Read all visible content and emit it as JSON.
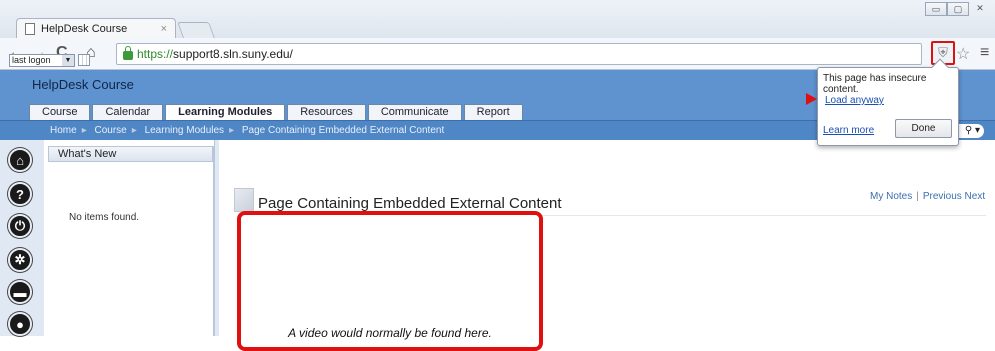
{
  "browser": {
    "tab_title": "HelpDesk Course",
    "tab_close": "×",
    "url_https": "https://",
    "url_rest": "support8.sln.suny.edu/",
    "win_controls": [
      "▭",
      "▢",
      "✕"
    ]
  },
  "lms": {
    "course_title": "HelpDesk Course",
    "nav_tabs": [
      "Course",
      "Calendar",
      "Learning Modules",
      "Resources",
      "Communicate",
      "Report"
    ],
    "breadcrumb": [
      "Home",
      "Course",
      "Learning Modules",
      "Page Containing Embedded External Content"
    ],
    "pill_text": "⚲ ▾"
  },
  "sidebar": {
    "panel_title": "What's New",
    "filter_value": "last logon",
    "empty_text": "No items found."
  },
  "content": {
    "page_title": "Page Containing Embedded External Content",
    "pager": [
      "My Notes",
      "Previous",
      "Next"
    ],
    "video_placeholder": "A video would normally be found here."
  },
  "popup": {
    "message": "This page has insecure content.",
    "load_link": "Load anyway",
    "learn_link": "Learn more",
    "done_label": "Done"
  },
  "colors": {
    "header_blue": "#5e93d0",
    "highlight_red": "#e01010",
    "link_blue": "#1a4fb3"
  }
}
